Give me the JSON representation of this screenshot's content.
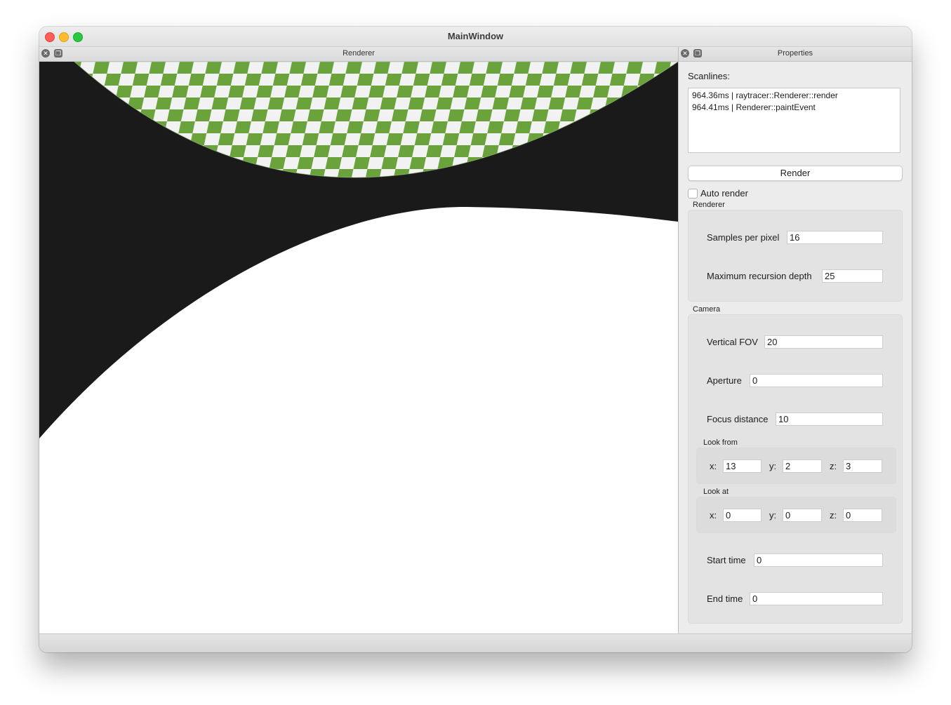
{
  "window": {
    "title": "MainWindow"
  },
  "renderer_dock": {
    "title": "Renderer"
  },
  "properties_dock": {
    "title": "Properties",
    "scanlines_label": "Scanlines:",
    "log_lines": [
      "964.36ms | raytracer::Renderer::render",
      "964.41ms | Renderer::paintEvent"
    ],
    "render_button": "Render",
    "auto_render_label": "Auto render",
    "auto_render_checked": false,
    "renderer_group": {
      "title": "Renderer",
      "samples_label": "Samples per pixel",
      "samples_value": "16",
      "depth_label": "Maximum recursion depth",
      "depth_value": "25"
    },
    "camera_group": {
      "title": "Camera",
      "fov_label": "Vertical FOV",
      "fov_value": "20",
      "aperture_label": "Aperture",
      "aperture_value": "0",
      "focus_label": "Focus distance",
      "focus_value": "10",
      "look_from": {
        "title": "Look from",
        "x_label": "x:",
        "x": "13",
        "y_label": "y:",
        "y": "2",
        "z_label": "z:",
        "z": "3"
      },
      "look_at": {
        "title": "Look at",
        "x_label": "x:",
        "x": "0",
        "y_label": "y:",
        "y": "0",
        "z_label": "z:",
        "z": "0"
      },
      "start_label": "Start time",
      "start_value": "0",
      "end_label": "End time",
      "end_value": "0"
    }
  },
  "colors": {
    "checker_green": "#6aa23c",
    "checker_white": "#f2f2f2",
    "background_dark": "#1a1a1a"
  }
}
